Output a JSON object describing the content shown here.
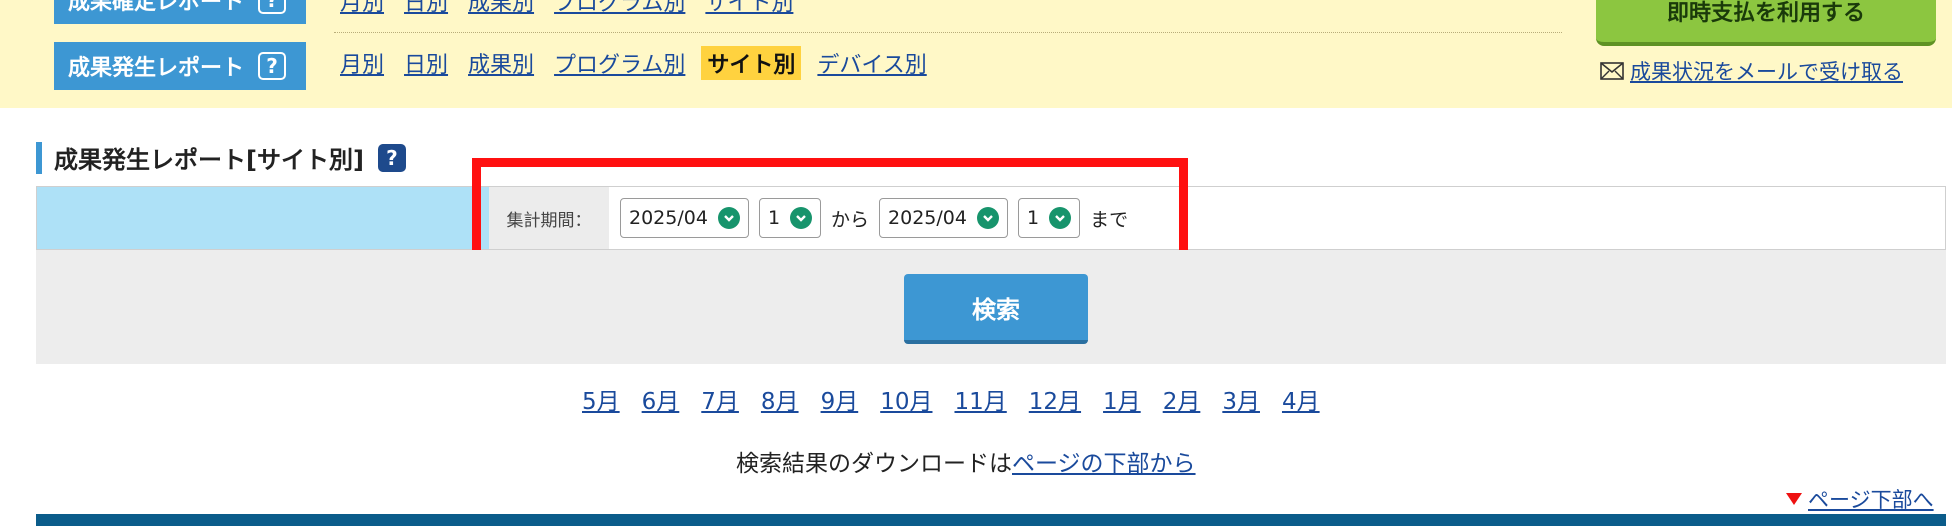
{
  "header": {
    "row1": {
      "label": "成果確定レポート",
      "tabs": [
        "月別",
        "日別",
        "成果別",
        "プログラム別",
        "サイト別"
      ]
    },
    "row2": {
      "label": "成果発生レポート",
      "tabs": [
        "月別",
        "日別",
        "成果別",
        "プログラム別",
        "サイト別",
        "デバイス別"
      ],
      "active_tab": "サイト別"
    },
    "help_glyph": "?",
    "instant_pay_button": "即時支払を利用する",
    "mail_link": "成果状況をメールで受け取る"
  },
  "section": {
    "title": "成果発生レポート[サイト別]",
    "help_glyph": "?"
  },
  "filter": {
    "period_label": "集計期間：",
    "from_month": "2025/04",
    "from_day": "1",
    "from_text": "から",
    "to_month": "2025/04",
    "to_day": "1",
    "to_text": "まで"
  },
  "search": {
    "button_label": "検索"
  },
  "months": [
    "5月",
    "6月",
    "7月",
    "8月",
    "9月",
    "10月",
    "11月",
    "12月",
    "1月",
    "2月",
    "3月",
    "4月"
  ],
  "download": {
    "text": "検索結果のダウンロードは",
    "link": "ページの下部から"
  },
  "page_bottom_link": "ページ下部へ",
  "colors": {
    "accent_blue": "#3d97d3",
    "top_band": "#fff8c7",
    "active_tab": "#ffd23f",
    "green_button": "#8cc640",
    "highlight_red": "#ff1010",
    "dropdown_green": "#17946c",
    "navy": "#0b5c8a"
  },
  "icons": {
    "help": "question-icon",
    "mail": "mail-icon",
    "dropdown": "chevron-down-circle-icon",
    "page_bottom": "triangle-down-icon"
  }
}
